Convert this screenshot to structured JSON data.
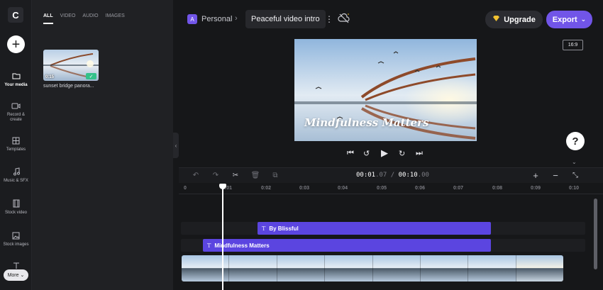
{
  "app": {
    "logo": "C"
  },
  "rail": {
    "add_label": "+",
    "items": [
      {
        "label": "Your media",
        "icon": "folder-icon"
      },
      {
        "label": "Record & create",
        "icon": "camera-icon"
      },
      {
        "label": "Templates",
        "icon": "templates-icon"
      },
      {
        "label": "Music & SFX",
        "icon": "music-icon"
      },
      {
        "label": "Stock video",
        "icon": "film-icon"
      },
      {
        "label": "Stock images",
        "icon": "image-icon"
      },
      {
        "label": "Text",
        "icon": "text-icon"
      }
    ],
    "more_label": "More"
  },
  "media": {
    "tabs": [
      "ALL",
      "VIDEO",
      "AUDIO",
      "IMAGES"
    ],
    "active_tab": "ALL",
    "items": [
      {
        "name": "sunset bridge panora...",
        "duration": "0:15",
        "added": true
      }
    ]
  },
  "header": {
    "workspace_initial": "A",
    "workspace": "Personal",
    "separator": "›",
    "project_title": "Peaceful video intro",
    "upgrade_label": "Upgrade",
    "export_label": "Export",
    "aspect_ratio": "16:9"
  },
  "preview": {
    "overlay_text": "Mindfulness Matters"
  },
  "timeline": {
    "current": "00:01",
    "current_frac": ".07",
    "sep": " / ",
    "total": "00:10",
    "total_frac": ".00",
    "ticks": [
      "0",
      "0:01",
      "0:02",
      "0:03",
      "0:04",
      "0:05",
      "0:06",
      "0:07",
      "0:08",
      "0:09",
      "0:10"
    ],
    "clips": [
      {
        "label": "By Blissful",
        "type": "text"
      },
      {
        "label": "Mindfulness Matters",
        "type": "text"
      }
    ]
  },
  "colors": {
    "accent": "#7155e8",
    "clip": "#5b45e0",
    "success": "#33c18a",
    "bg": "#161719"
  }
}
